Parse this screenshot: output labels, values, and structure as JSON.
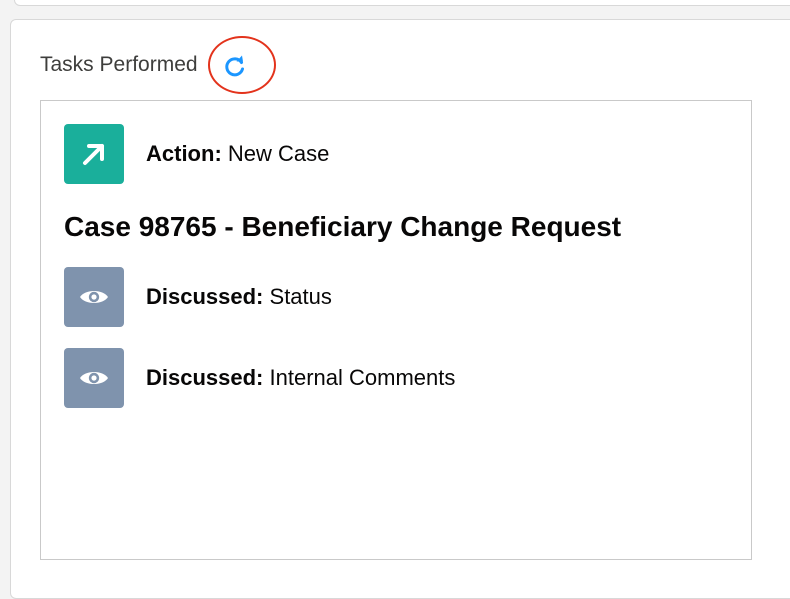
{
  "panel": {
    "title": "Tasks Performed",
    "refresh_icon": "refresh-icon"
  },
  "colors": {
    "action_icon_bg": "#1aaf9b",
    "discussed_icon_bg": "#7f93ad",
    "refresh_blue": "#1b96ff",
    "highlight_red": "#e3331c"
  },
  "tasks": [
    {
      "icon": "arrow-up-right-icon",
      "label": "Action:",
      "value": "New Case"
    },
    {
      "icon": "eye-icon",
      "label": "Discussed:",
      "value": "Status"
    },
    {
      "icon": "eye-icon",
      "label": "Discussed:",
      "value": "Internal Comments"
    }
  ],
  "case": {
    "heading": "Case 98765 - Beneficiary Change Request"
  }
}
